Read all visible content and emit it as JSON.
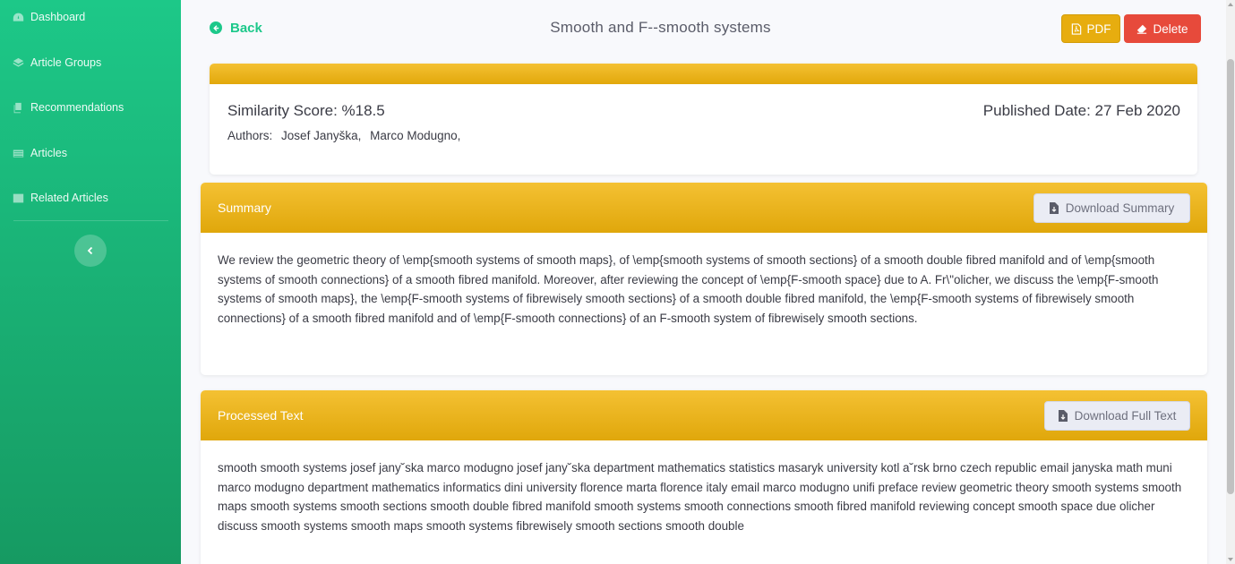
{
  "sidebar": {
    "items": [
      {
        "label": "Dashboard",
        "icon": "dashboard-icon"
      },
      {
        "label": "Article Groups",
        "icon": "layers-icon"
      },
      {
        "label": "Recommendations",
        "icon": "copy-icon"
      },
      {
        "label": "Articles",
        "icon": "list-icon"
      },
      {
        "label": "Related Articles",
        "icon": "table-icon"
      }
    ],
    "toggle_icon": "chevron-left-icon"
  },
  "header": {
    "back_label": "Back",
    "title": "Smooth and F--smooth systems",
    "pdf_label": "PDF",
    "delete_label": "Delete"
  },
  "info": {
    "similarity": "Similarity Score: %18.5",
    "published": "Published Date: 27 Feb 2020",
    "authors_label": "Authors:",
    "authors": [
      "Josef Janyška,",
      "Marco Modugno,"
    ]
  },
  "summary": {
    "title": "Summary",
    "download_label": "Download Summary",
    "text": "We review the geometric theory of \\emp{smooth systems of smooth maps}, of \\emp{smooth systems of smooth sections} of a smooth double fibred manifold and of \\emp{smooth systems of smooth connections} of a smooth fibred manifold. Moreover, after reviewing the concept of \\emp{F-smooth space} due to A. Fr\\\"olicher, we discuss the \\emp{F-smooth systems of smooth maps}, the \\emp{F-smooth systems of fibrewisely smooth sections} of a smooth double fibred manifold, the \\emp{F-smooth systems of fibrewisely smooth connections} of a smooth fibred manifold and of \\emp{F-smooth connections} of an F-smooth system of fibrewisely smooth sections."
  },
  "processed": {
    "title": "Processed Text",
    "download_label": "Download Full Text",
    "text": "smooth smooth systems josef jany˘ska marco modugno josef jany˘ska department mathematics statistics masaryk university kotl a˘rsk brno czech republic email janyska math muni marco modugno department mathematics informatics dini university florence marta florence italy email marco modugno unifi preface review geometric theory smooth systems smooth maps smooth systems smooth sections smooth double ﬁbred manifold smooth systems smooth connections smooth ﬁbred manifold reviewing concept smooth space due olicher discuss smooth systems smooth maps smooth systems ﬁbrewisely smooth sections smooth double"
  },
  "colors": {
    "sidebar_top": "#1dc888",
    "sidebar_bottom": "#169a62",
    "accent": "#1cc88a",
    "warning": "#f4c133",
    "danger": "#e74a3b"
  }
}
